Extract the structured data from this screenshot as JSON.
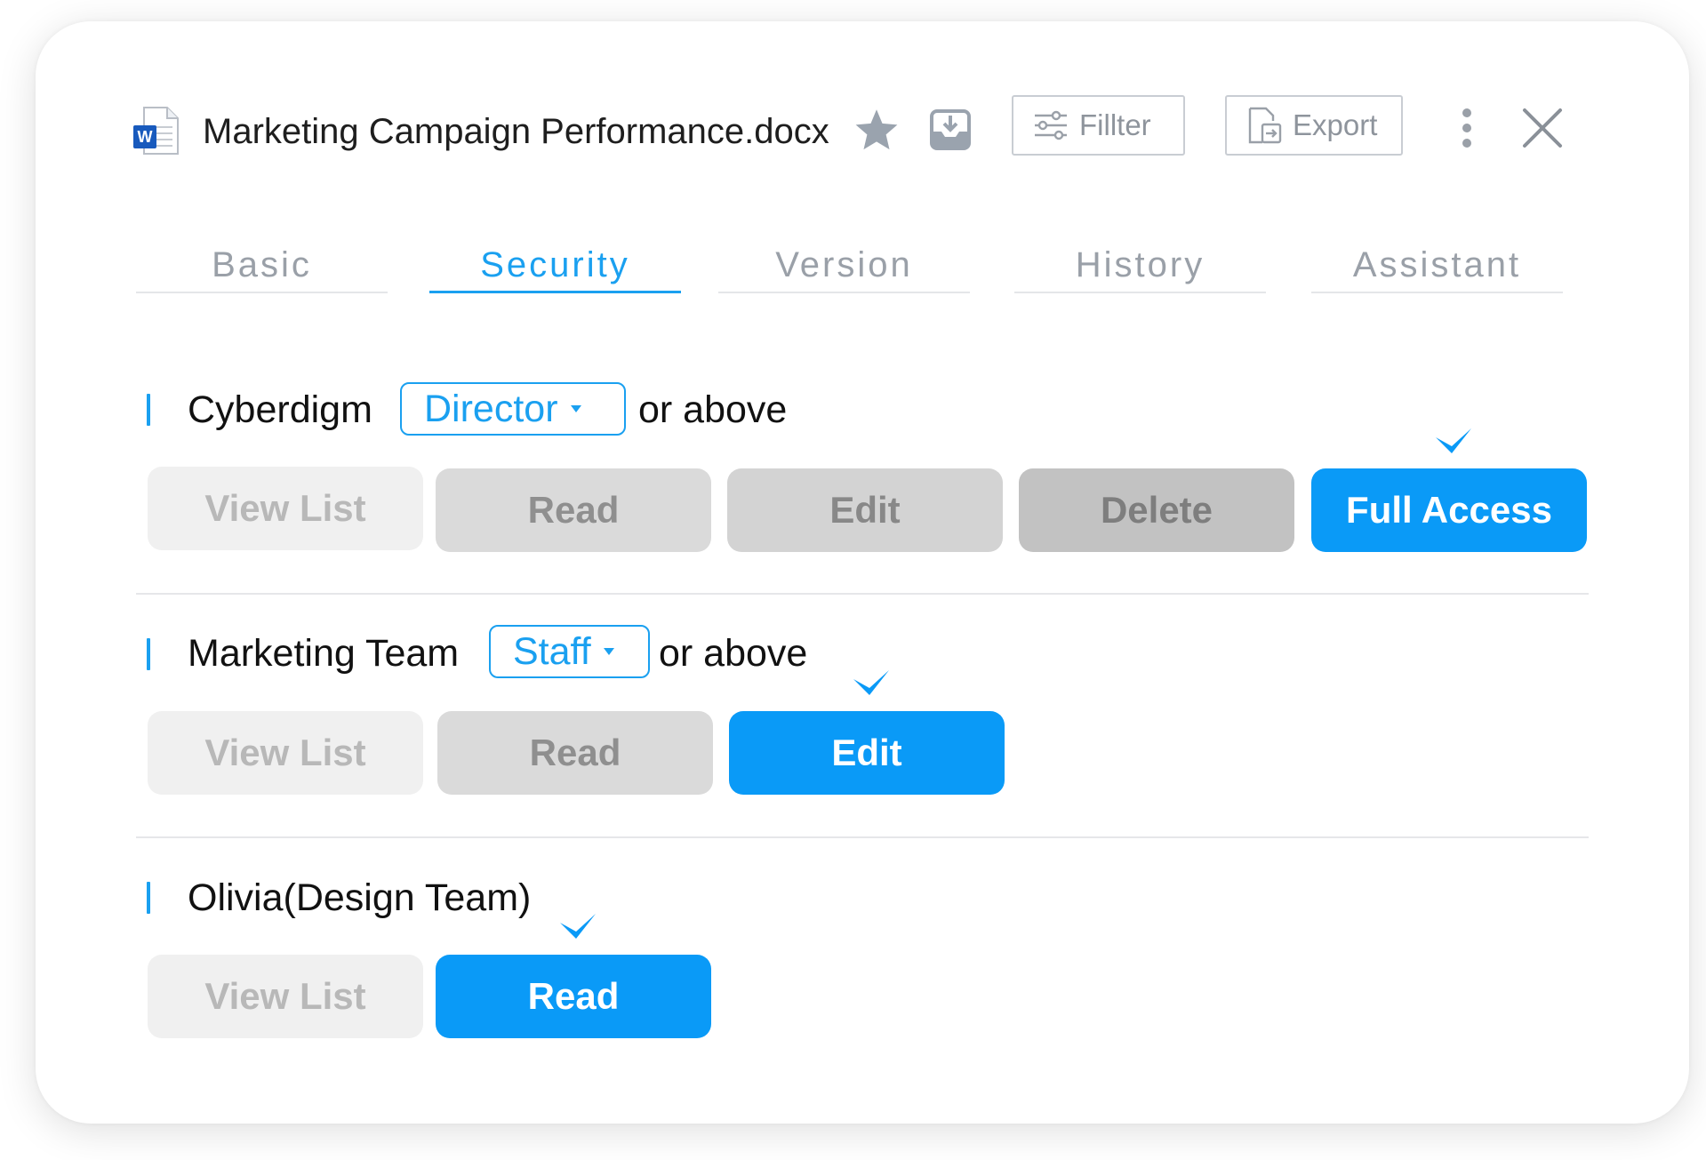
{
  "header": {
    "file_name": "Marketing Campaign Performance.docx",
    "file_type_badge": "W",
    "filter_label": "Fillter",
    "export_label": "Export",
    "icons": [
      "word-file-icon",
      "star-icon",
      "save-to-tray-icon",
      "filter-icon",
      "export-icon",
      "more-vertical-icon",
      "close-icon"
    ]
  },
  "tabs": [
    {
      "label": "Basic",
      "active": false
    },
    {
      "label": "Security",
      "active": true
    },
    {
      "label": "Version",
      "active": false
    },
    {
      "label": "History",
      "active": false
    },
    {
      "label": "Assistant",
      "active": false
    }
  ],
  "rules": [
    {
      "subject": "Cyberdigm",
      "role": "Director",
      "suffix": "or above",
      "permissions": [
        "View List",
        "Read",
        "Edit",
        "Delete",
        "Full Access"
      ],
      "selected": "Full Access"
    },
    {
      "subject": "Marketing Team",
      "role": "Staff",
      "suffix": "or above",
      "permissions": [
        "View List",
        "Read",
        "Edit"
      ],
      "selected": "Edit"
    },
    {
      "subject": "Olivia(Design Team)",
      "permissions": [
        "View List",
        "Read"
      ],
      "selected": "Read"
    }
  ],
  "colors": {
    "accent": "#1aa0f0",
    "selected_button": "#0a9af7",
    "word_blue": "#185abd"
  }
}
